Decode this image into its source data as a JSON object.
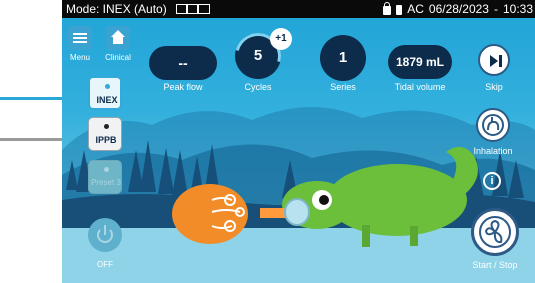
{
  "status_bar": {
    "mode": "Mode: INEX (Auto)",
    "power": "AC",
    "date": "06/28/2023",
    "time": "10:33"
  },
  "nav": {
    "menu_label": "Menu",
    "clinical_label": "Clinical"
  },
  "readouts": {
    "peak_flow": {
      "value": "--",
      "label": "Peak flow"
    },
    "cycles": {
      "value": "5",
      "label": "Cycles",
      "badge": "+1"
    },
    "series": {
      "value": "1",
      "label": "Series"
    },
    "tidal_volume": {
      "value": "1879 mL",
      "label": "Tidal volume"
    }
  },
  "modes": {
    "inex": "INEX",
    "ippb": "IPPB",
    "preset": "Preset 3",
    "off": "OFF"
  },
  "actions": {
    "skip": "Skip",
    "inhalation": "Inhalation",
    "start_stop": "Start / Stop"
  },
  "colors": {
    "accent": "#34a8d6",
    "dark": "#0d2b4a",
    "annotation_arrow_blue": "#29a6d8",
    "annotation_arrow_gray": "#9a9a9a"
  }
}
